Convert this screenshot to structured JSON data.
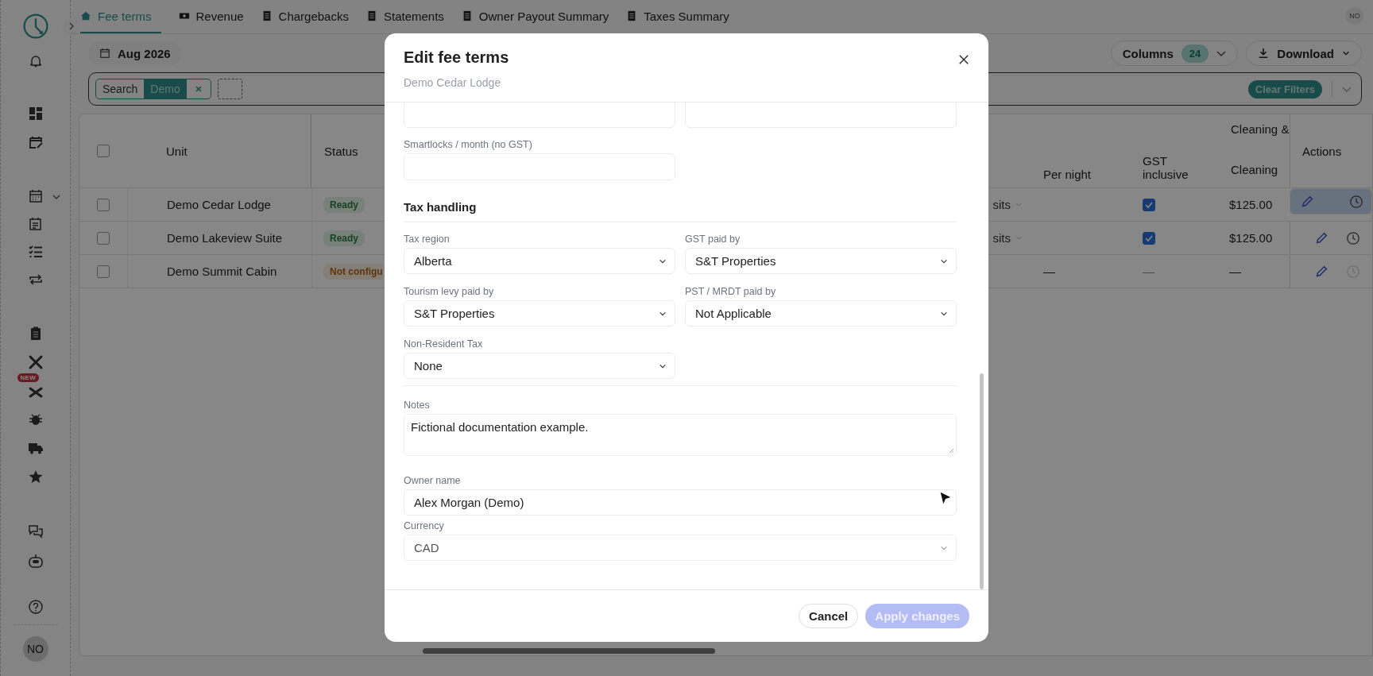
{
  "sidebar": {
    "badge": "NEW",
    "avatar": "NO"
  },
  "header": {
    "avatar": "NO"
  },
  "tabs": [
    {
      "label": "Fee terms",
      "selected": true
    },
    {
      "label": "Revenue",
      "selected": false
    },
    {
      "label": "Chargebacks",
      "selected": false
    },
    {
      "label": "Statements",
      "selected": false
    },
    {
      "label": "Owner Payout Summary",
      "selected": false
    },
    {
      "label": "Taxes Summary",
      "selected": false
    }
  ],
  "toolbar": {
    "date": "Aug 2026",
    "columns_label": "Columns",
    "columns_count": "24",
    "download": "Download"
  },
  "filters": {
    "chips": [
      {
        "field": "Search",
        "value": "Demo"
      }
    ],
    "clear": "Clear Filters"
  },
  "table": {
    "all_checked": false,
    "columns": [
      {
        "label": "Unit"
      },
      {
        "label": "Status"
      },
      {
        "label": "Per night"
      },
      {
        "label": "GST inclusive"
      },
      {
        "label": "Cleaning",
        "group": "Cleaning &"
      },
      {
        "label": "Actions"
      }
    ],
    "rows": [
      {
        "checked": false,
        "selected": true,
        "unit": "Demo Cedar Lodge",
        "status": "Ready",
        "configured": true,
        "column_4": "sits",
        "gst": {
          "kind": "checkbox",
          "checked": true
        },
        "cleaning": "$125.00",
        "history_enabled": true
      },
      {
        "checked": false,
        "selected": false,
        "unit": "Demo Lakeview Suite",
        "status": "Ready",
        "configured": true,
        "column_4": "sits",
        "gst": {
          "kind": "checkbox",
          "checked": true
        },
        "cleaning": "$125.00",
        "history_enabled": true
      },
      {
        "checked": false,
        "selected": false,
        "unit": "Demo Summit Cabin",
        "status": "Not configu",
        "configured": false,
        "per_night": "—",
        "gst": {
          "kind": "text",
          "text": "—"
        },
        "cleaning": "—",
        "history_enabled": false
      }
    ]
  },
  "modal": {
    "title": "Edit fee terms",
    "subtitle": "Demo Cedar Lodge",
    "smartlocks": {
      "label": "Smartlocks / month (no GST)"
    },
    "tax_handling": {
      "title": "Tax handling",
      "fields": [
        {
          "label": "Tax region",
          "value": "Alberta"
        },
        {
          "label": "GST paid by",
          "value": "S&T Properties"
        },
        {
          "label": "Tourism levy paid by",
          "value": "S&T Properties"
        },
        {
          "label": "PST / MRDT paid by",
          "value": "Not Applicable"
        },
        {
          "label": "Non-Resident Tax",
          "value": "None"
        }
      ]
    },
    "notes": {
      "label": "Notes",
      "value": "Fictional documentation example."
    },
    "owner_name": {
      "label": "Owner name",
      "value": "Alex Morgan (Demo)"
    },
    "currency": {
      "label": "Currency",
      "value": "CAD",
      "disabled": true
    },
    "buttons": [
      {
        "label": "Cancel",
        "kind": "secondary",
        "disabled": false
      },
      {
        "label": "Apply changes",
        "kind": "primary",
        "disabled": true
      }
    ]
  }
}
